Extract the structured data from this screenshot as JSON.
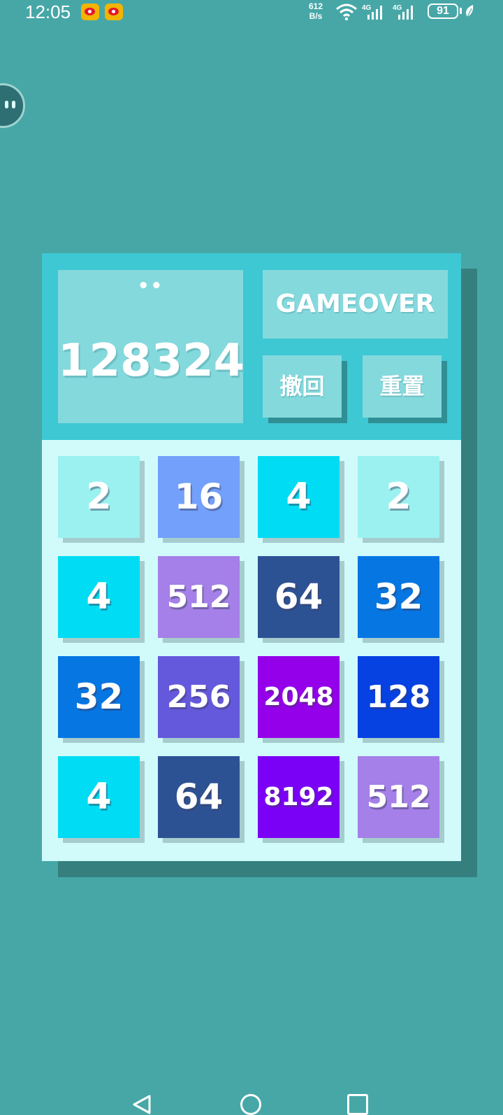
{
  "status_bar": {
    "time": "12:05",
    "net_speed_value": "612",
    "net_speed_unit": "B/s",
    "network_1": "4G",
    "network_2": "4G",
    "battery": "91",
    "icons": [
      "weibo-icon",
      "weibo-icon",
      "wifi-icon",
      "signal-icon",
      "signal-icon",
      "battery-icon",
      "leaf-icon"
    ]
  },
  "game": {
    "score_label": "••",
    "score": "128324",
    "status": "GAMEOVER",
    "undo_label": "撤回",
    "reset_label": "重置",
    "board": [
      [
        "2",
        "16",
        "4",
        "2"
      ],
      [
        "4",
        "512",
        "64",
        "32"
      ],
      [
        "32",
        "256",
        "2048",
        "128"
      ],
      [
        "4",
        "64",
        "8192",
        "512"
      ]
    ],
    "tile_colors": {
      "2": "#9af1f0",
      "4": "#00dcf3",
      "16": "#72a0fb",
      "32": "#0676e3",
      "64": "#2d5294",
      "128": "#0641e2",
      "256": "#6459dc",
      "512": "#a480e8",
      "2048": "#9400e9",
      "8192": "#7b00f6"
    }
  },
  "colors": {
    "background": "#47a7a7",
    "header": "#3dc8d3",
    "board": "#d1fbfb"
  }
}
